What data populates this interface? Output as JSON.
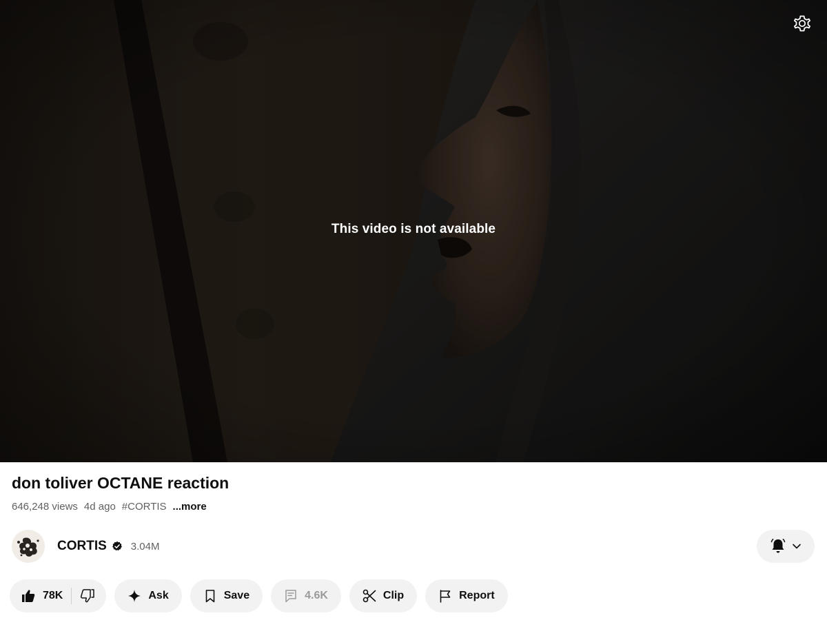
{
  "player": {
    "status_message": "This video is not available",
    "settings_icon": "gear-icon"
  },
  "video": {
    "title": "don toliver OCTANE reaction",
    "views": "646,248 views",
    "age": "4d ago",
    "hashtag": "#CORTIS",
    "more_label": "...more"
  },
  "channel": {
    "name": "CORTIS",
    "verified_icon": "verified-badge-icon",
    "subscribers": "3.04M",
    "subscribe_icon": "bell-icon"
  },
  "actions": {
    "like_count": "78K",
    "ask_label": "Ask",
    "save_label": "Save",
    "comments_count": "4.6K",
    "clip_label": "Clip",
    "report_label": "Report"
  },
  "colors": {
    "text_primary": "#0f0f0f",
    "text_secondary": "#606060",
    "pill_background": "#f2f2f2",
    "disabled_text": "#9a9a9a"
  }
}
